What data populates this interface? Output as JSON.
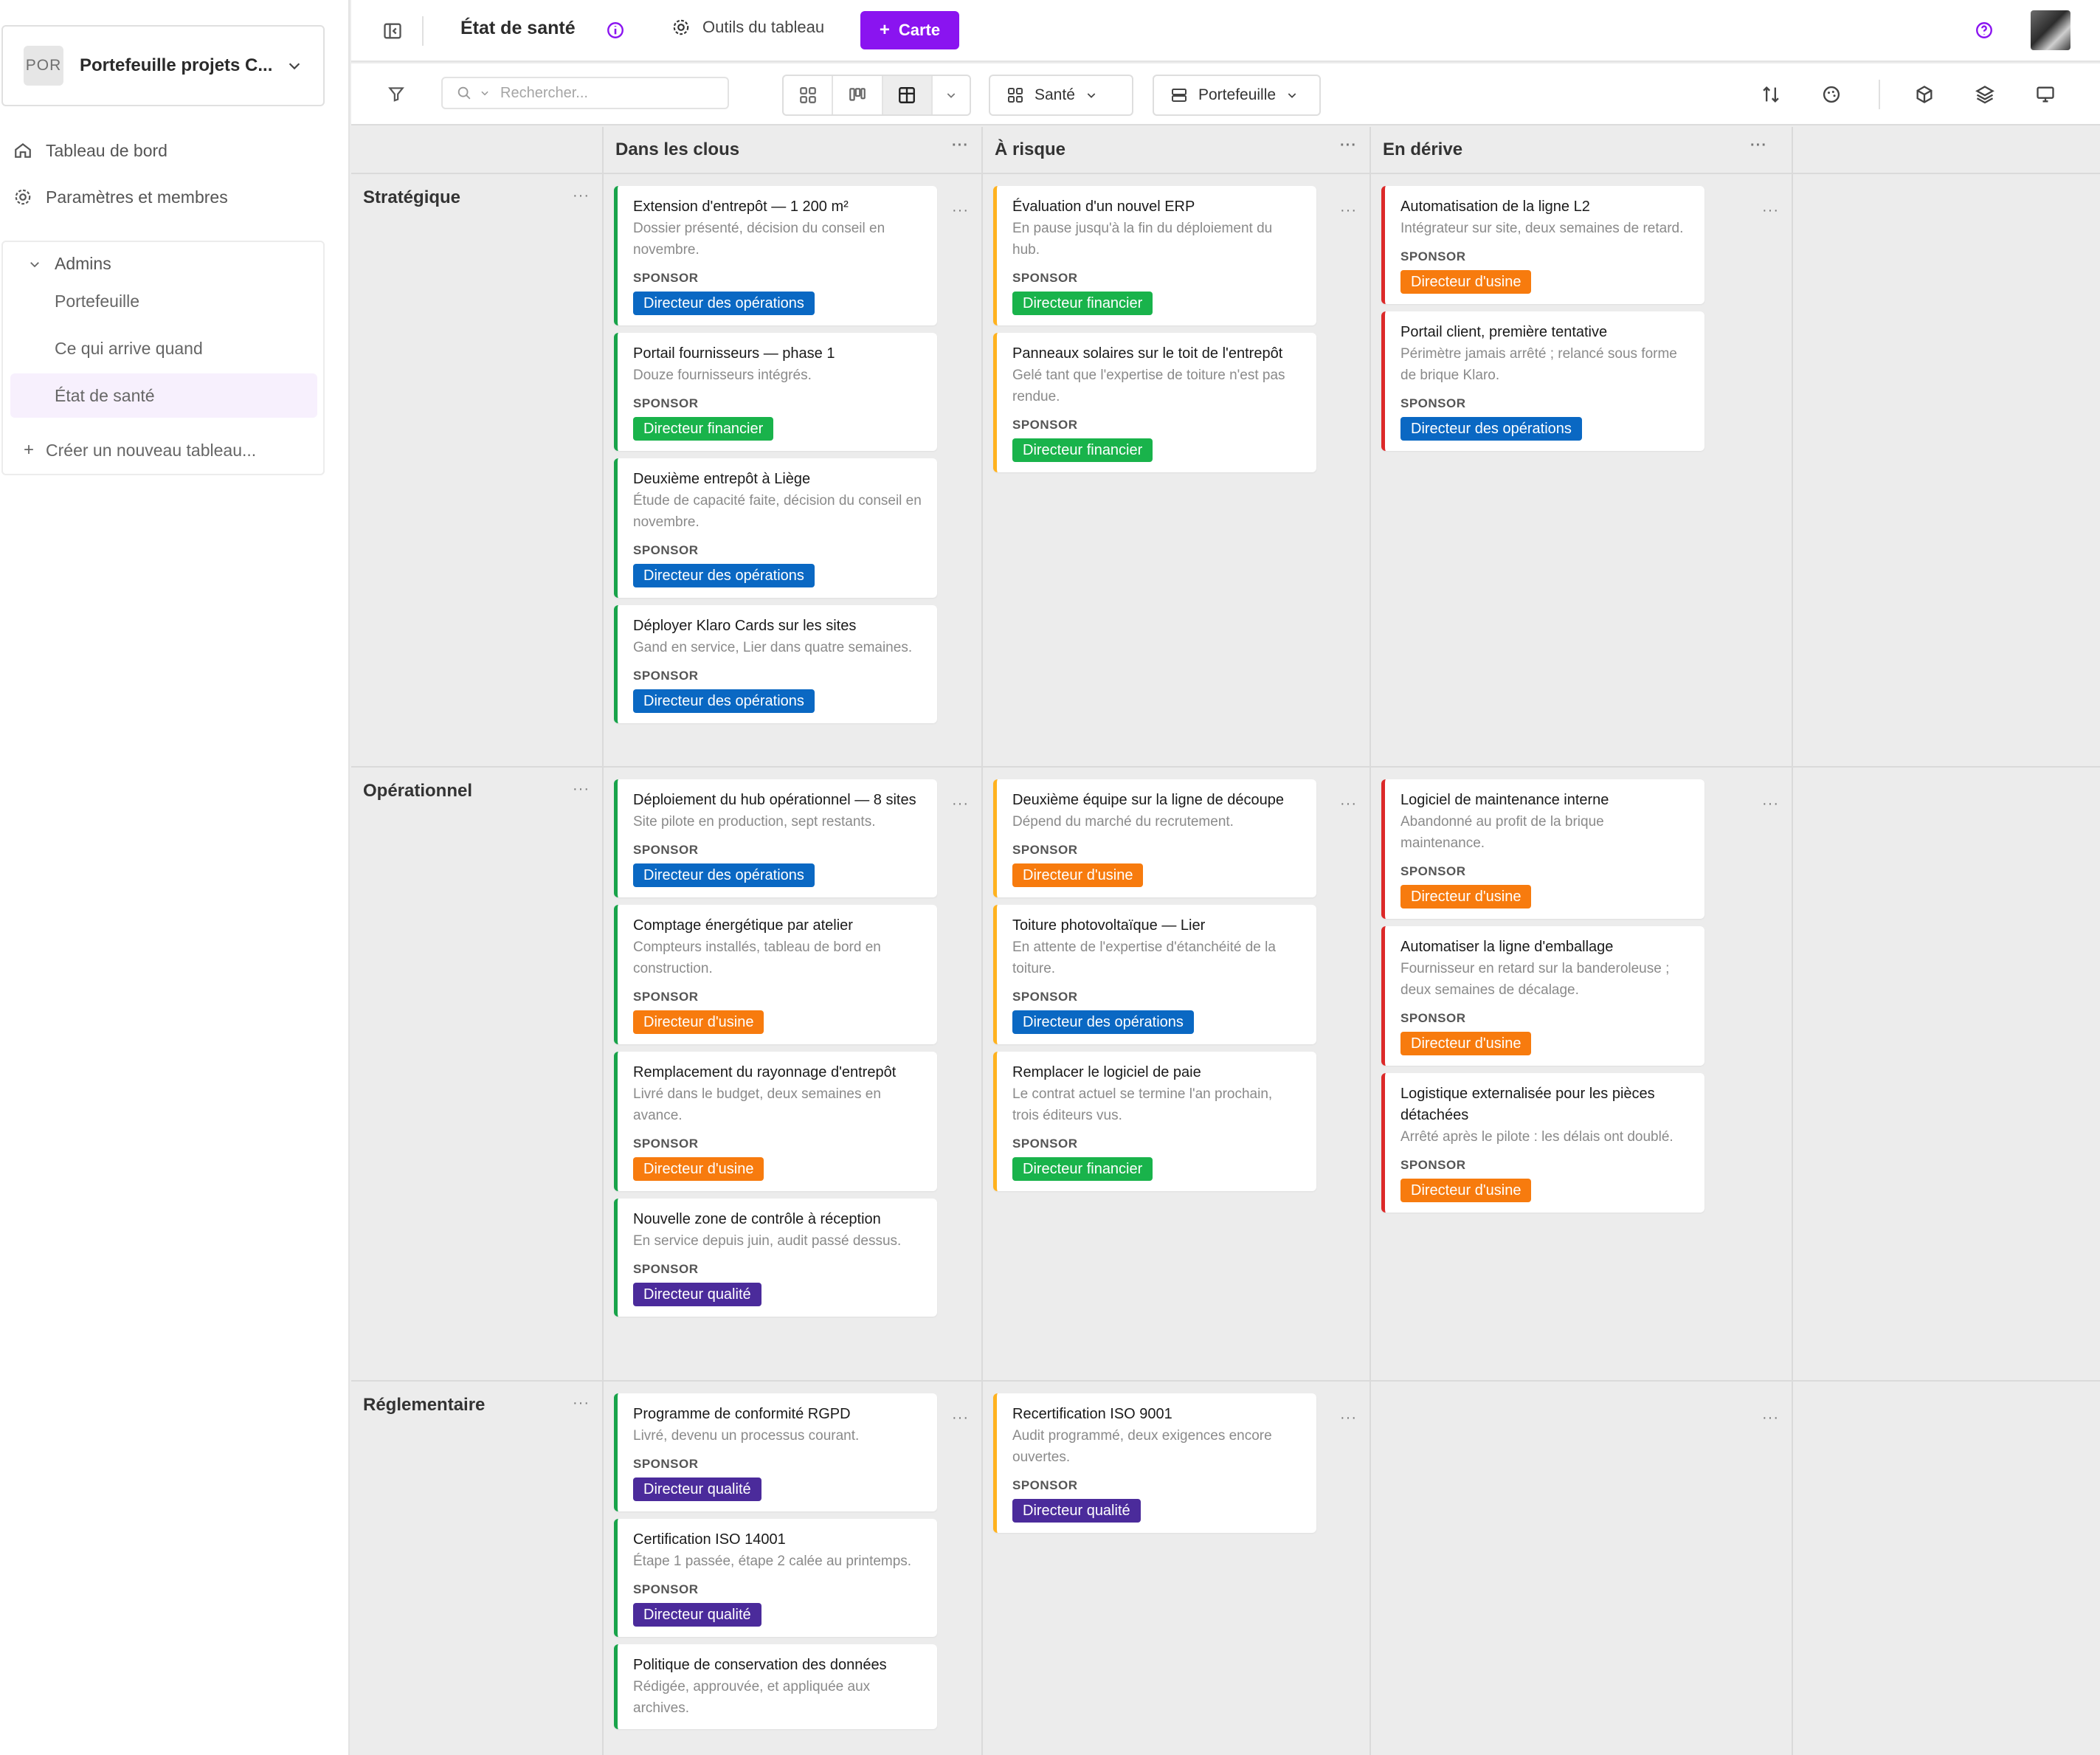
{
  "sidebar": {
    "workspace_badge": "POR",
    "workspace_name": "Portefeuille projets C...",
    "nav": {
      "dashboard": "Tableau de bord",
      "settings": "Paramètres et membres"
    },
    "group": {
      "title": "Admins",
      "items": [
        "Portefeuille",
        "Ce qui arrive quand",
        "État de santé"
      ],
      "create": "Créer un nouveau tableau..."
    }
  },
  "header": {
    "title": "État de santé",
    "tools": "Outils du tableau",
    "add_card": "Carte"
  },
  "toolbar": {
    "search_placeholder": "Rechercher...",
    "group_by": "Santé",
    "swimlane": "Portefeuille"
  },
  "columns": [
    "Dans les clous",
    "À risque",
    "En dérive"
  ],
  "rows": [
    "Stratégique",
    "Opérationnel",
    "Réglementaire"
  ],
  "sponsor_label": "SPONSOR",
  "colors": {
    "on_track": "#18a34a",
    "at_risk": "#ffb21f",
    "off_track": "#dc2929",
    "accent": "#8a14f0"
  },
  "cells": {
    "r0": {
      "c0": [
        {
          "title": "Extension d'entrepôt — 1 200 m²",
          "desc": "Dossier présenté, décision du conseil en novembre.",
          "tag": "Directeur des opérations",
          "tagc": "t-ops"
        },
        {
          "title": "Portail fournisseurs — phase 1",
          "desc": "Douze fournisseurs intégrés.",
          "tag": "Directeur financier",
          "tagc": "t-fin"
        },
        {
          "title": "Deuxième entrepôt à Liège",
          "desc": "Étude de capacité faite, décision du conseil en novembre.",
          "tag": "Directeur des opérations",
          "tagc": "t-ops"
        },
        {
          "title": "Déployer Klaro Cards sur les sites",
          "desc": "Gand en service, Lier dans quatre semaines.",
          "tag": "Directeur des opérations",
          "tagc": "t-ops"
        }
      ],
      "c1": [
        {
          "title": "Évaluation d'un nouvel ERP",
          "desc": "En pause jusqu'à la fin du déploiement du hub.",
          "tag": "Directeur financier",
          "tagc": "t-fin"
        },
        {
          "title": "Panneaux solaires sur le toit de l'entrepôt",
          "desc": "Gelé tant que l'expertise de toiture n'est pas rendue.",
          "tag": "Directeur financier",
          "tagc": "t-fin"
        }
      ],
      "c2": [
        {
          "title": "Automatisation de la ligne L2",
          "desc": "Intégrateur sur site, deux semaines de retard.",
          "tag": "Directeur d'usine",
          "tagc": "t-usine"
        },
        {
          "title": "Portail client, première tentative",
          "desc": "Périmètre jamais arrêté ; relancé sous forme de brique Klaro.",
          "tag": "Directeur des opérations",
          "tagc": "t-ops"
        }
      ]
    },
    "r1": {
      "c0": [
        {
          "title": "Déploiement du hub opérationnel — 8 sites",
          "desc": "Site pilote en production, sept restants.",
          "tag": "Directeur des opérations",
          "tagc": "t-ops"
        },
        {
          "title": "Comptage énergétique par atelier",
          "desc": "Compteurs installés, tableau de bord en construction.",
          "tag": "Directeur d'usine",
          "tagc": "t-usine"
        },
        {
          "title": "Remplacement du rayonnage d'entrepôt",
          "desc": "Livré dans le budget, deux semaines en avance.",
          "tag": "Directeur d'usine",
          "tagc": "t-usine"
        },
        {
          "title": "Nouvelle zone de contrôle à réception",
          "desc": "En service depuis juin, audit passé dessus.",
          "tag": "Directeur qualité",
          "tagc": "t-qual"
        }
      ],
      "c1": [
        {
          "title": "Deuxième équipe sur la ligne de découpe",
          "desc": "Dépend du marché du recrutement.",
          "tag": "Directeur d'usine",
          "tagc": "t-usine"
        },
        {
          "title": "Toiture photovoltaïque — Lier",
          "desc": "En attente de l'expertise d'étanchéité de la toiture.",
          "tag": "Directeur des opérations",
          "tagc": "t-ops"
        },
        {
          "title": "Remplacer le logiciel de paie",
          "desc": "Le contrat actuel se termine l'an prochain, trois éditeurs vus.",
          "tag": "Directeur financier",
          "tagc": "t-fin"
        }
      ],
      "c2": [
        {
          "title": "Logiciel de maintenance interne",
          "desc": "Abandonné au profit de la brique maintenance.",
          "tag": "Directeur d'usine",
          "tagc": "t-usine"
        },
        {
          "title": "Automatiser la ligne d'emballage",
          "desc": "Fournisseur en retard sur la banderoleuse ; deux semaines de décalage.",
          "tag": "Directeur d'usine",
          "tagc": "t-usine"
        },
        {
          "title": "Logistique externalisée pour les pièces détachées",
          "desc": "Arrêté après le pilote : les délais ont doublé.",
          "tag": "Directeur d'usine",
          "tagc": "t-usine"
        }
      ]
    },
    "r2": {
      "c0": [
        {
          "title": "Programme de conformité RGPD",
          "desc": "Livré, devenu un processus courant.",
          "tag": "Directeur qualité",
          "tagc": "t-qual"
        },
        {
          "title": "Certification ISO 14001",
          "desc": "Étape 1 passée, étape 2 calée au printemps.",
          "tag": "Directeur qualité",
          "tagc": "t-qual"
        },
        {
          "title": "Politique de conservation des données",
          "desc": "Rédigée, approuvée, et appliquée aux archives.",
          "tag": "",
          "tagc": ""
        }
      ],
      "c1": [
        {
          "title": "Recertification ISO 9001",
          "desc": "Audit programmé, deux exigences encore ouvertes.",
          "tag": "Directeur qualité",
          "tagc": "t-qual"
        }
      ],
      "c2": []
    }
  }
}
